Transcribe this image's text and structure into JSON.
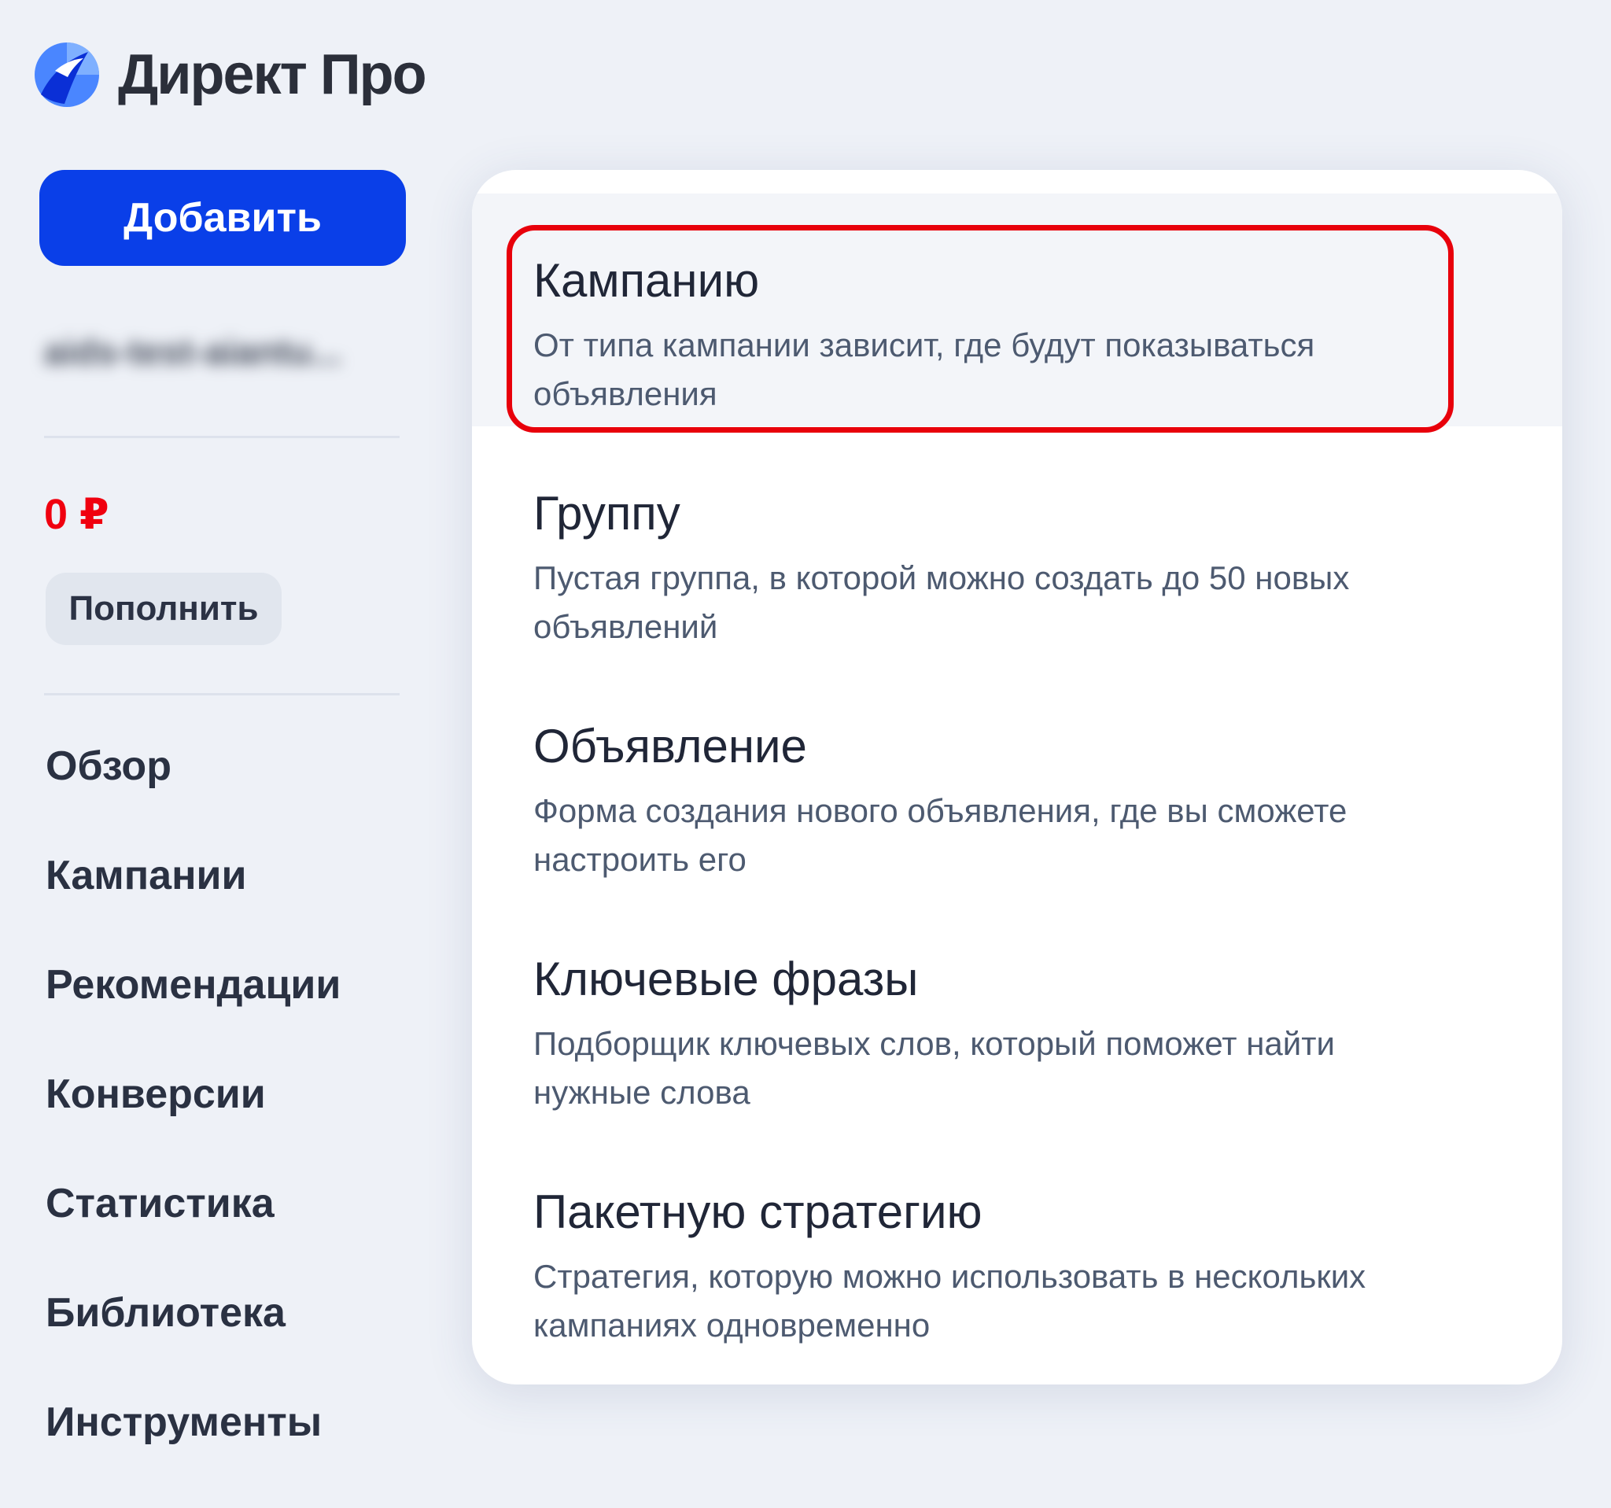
{
  "brand": {
    "name": "Директ Про",
    "logo_icon": "yandex-direct-logo-icon",
    "colors": {
      "logo_light": "#4a86ff",
      "logo_dark": "#0a2fd6"
    }
  },
  "sidebar": {
    "add_button_label": "Добавить",
    "account_name": "aids-test-aiantu...",
    "balance": "0 ₽",
    "topup_label": "Пополнить",
    "nav": [
      {
        "label": "Обзор"
      },
      {
        "label": "Кампании"
      },
      {
        "label": "Рекомендации"
      },
      {
        "label": "Конверсии"
      },
      {
        "label": "Статистика"
      },
      {
        "label": "Библиотека"
      },
      {
        "label": "Инструменты"
      }
    ]
  },
  "add_menu": {
    "items": [
      {
        "title": "Кампанию",
        "description": "От типа кампании зависит, где будут показываться объявления",
        "active": true
      },
      {
        "title": "Группу",
        "description": "Пустая группа, в которой можно создать до 50 новых объявлений"
      },
      {
        "title": "Объявление",
        "description": "Форма создания нового объявления, где вы сможете настроить его"
      },
      {
        "title": "Ключевые фразы",
        "description": "Подборщик ключевых слов, который поможет найти нужные слова"
      },
      {
        "title": "Пакетную стратегию",
        "description": "Стратегия, которую можно использовать в нескольких кампаниях одновременно"
      }
    ]
  },
  "colors": {
    "background": "#eef1f7",
    "primary_button": "#0a3fe8",
    "balance_text": "#f0000f",
    "highlight_outline": "#e8000b"
  }
}
